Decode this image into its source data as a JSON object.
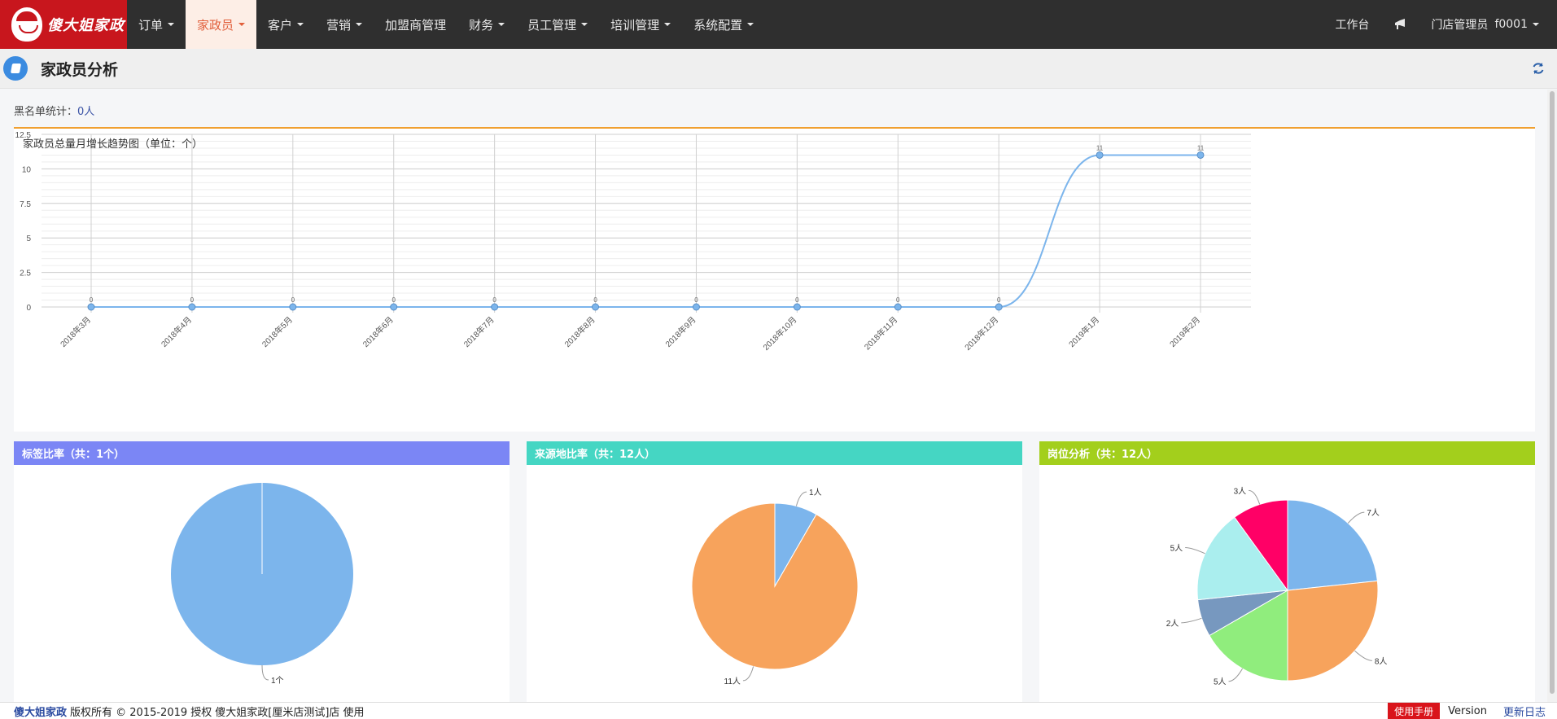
{
  "logo": {
    "text": "傻大姐家政"
  },
  "nav": {
    "items": [
      {
        "label": "订单",
        "dropdown": true,
        "active": false
      },
      {
        "label": "家政员",
        "dropdown": true,
        "active": true
      },
      {
        "label": "客户",
        "dropdown": true,
        "active": false
      },
      {
        "label": "营销",
        "dropdown": true,
        "active": false
      },
      {
        "label": "加盟商管理",
        "dropdown": false,
        "active": false
      },
      {
        "label": "财务",
        "dropdown": true,
        "active": false
      },
      {
        "label": "员工管理",
        "dropdown": true,
        "active": false
      },
      {
        "label": "培训管理",
        "dropdown": true,
        "active": false
      },
      {
        "label": "系统配置",
        "dropdown": true,
        "active": false
      }
    ],
    "workbench": "工作台",
    "user": "门店管理员",
    "user_id": "f0001",
    "bell_icon": "notification-icon"
  },
  "page": {
    "title": "家政员分析",
    "icon": "book-icon",
    "refresh_icon": "refresh-icon"
  },
  "blacklist": {
    "label": "黑名单统计：",
    "value": "0人"
  },
  "trend": {
    "title": "家政员总量月增长趋势图（单位：个）"
  },
  "pies": [
    {
      "title": "标签比率（共：1个）",
      "color": "#7b86f5"
    },
    {
      "title": "来源地比率（共：12人）",
      "color": "#45d6c3"
    },
    {
      "title": "岗位分析（共：12人）",
      "color": "#a3cf1c"
    }
  ],
  "chart_data": [
    {
      "type": "line",
      "title": "家政员总量月增长趋势图（单位：个）",
      "categories": [
        "2018年3月",
        "2018年4月",
        "2018年5月",
        "2018年6月",
        "2018年7月",
        "2018年8月",
        "2018年9月",
        "2018年10月",
        "2018年11月",
        "2018年12月",
        "2019年1月",
        "2019年2月"
      ],
      "values": [
        0,
        0,
        0,
        0,
        0,
        0,
        0,
        0,
        0,
        0,
        11,
        11
      ],
      "point_labels": [
        "0",
        "0",
        "0",
        "0",
        "0",
        "0",
        "0",
        "0",
        "0",
        "0",
        "11",
        "11"
      ],
      "yticks": [
        "0",
        "2.5",
        "5",
        "7.5",
        "10",
        "12.5"
      ],
      "ylim": [
        0,
        12.5
      ],
      "grid": true,
      "color": "#7cb5ec"
    },
    {
      "type": "pie",
      "title": "标签比率（共：1个）",
      "slices": [
        {
          "label": "1个",
          "value": 1,
          "color": "#7cb5ec"
        }
      ]
    },
    {
      "type": "pie",
      "title": "来源地比率（共：12人）",
      "slices": [
        {
          "label": "1人",
          "value": 1,
          "color": "#7cb5ec"
        },
        {
          "label": "11人",
          "value": 11,
          "color": "#f7a35c"
        }
      ]
    },
    {
      "type": "pie",
      "title": "岗位分析（共：12人）",
      "slices": [
        {
          "label": "7人",
          "value": 7,
          "color": "#7cb5ec"
        },
        {
          "label": "8人",
          "value": 8,
          "color": "#f7a35c"
        },
        {
          "label": "5人",
          "value": 5,
          "color": "#90ed7d"
        },
        {
          "label": "2人",
          "value": 2,
          "color": "#7798bf"
        },
        {
          "label": "5人",
          "value": 5,
          "color": "#aaeeee"
        },
        {
          "label": "3人",
          "value": 3,
          "color": "#ff0066"
        }
      ]
    }
  ],
  "footer": {
    "brand": "傻大姐家政",
    "copyright": "版权所有 © 2015-2019 授权",
    "licensee": "傻大姐家政[厘米店测试]店 使用",
    "manual": "使用手册",
    "version": "Version",
    "changelog": "更新日志"
  }
}
